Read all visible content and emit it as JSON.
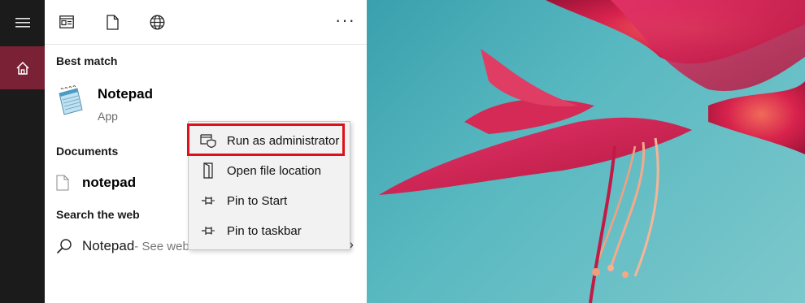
{
  "rail": {
    "menu_icon": "hamburger-icon",
    "home_icon": "home-icon"
  },
  "toolbar": {
    "icons": [
      "apps-view-icon",
      "document-icon",
      "web-globe-icon"
    ],
    "more_label": "···"
  },
  "best_match": {
    "title": "Best match",
    "app_name": "Notepad",
    "app_type": "App",
    "icon": "notepad-app-icon"
  },
  "documents": {
    "title": "Documents",
    "item": "notepad",
    "icon": "file-icon"
  },
  "search_web": {
    "title": "Search the web",
    "query": "Notepad",
    "suffix": " - See web results",
    "icon": "search-icon",
    "chevron": "›"
  },
  "context_menu": {
    "items": [
      {
        "label": "Run as administrator",
        "icon": "shield-window-icon"
      },
      {
        "label": "Open file location",
        "icon": "folder-open-icon"
      },
      {
        "label": "Pin to Start",
        "icon": "pin-icon"
      },
      {
        "label": "Pin to taskbar",
        "icon": "pin-icon"
      }
    ],
    "highlight_color": "#e0101a"
  },
  "colors": {
    "rail_bg": "#1b1b1b",
    "home_selected": "#7a2135",
    "photo_sky": "#4fb0bb",
    "flower": "#d8234d"
  }
}
